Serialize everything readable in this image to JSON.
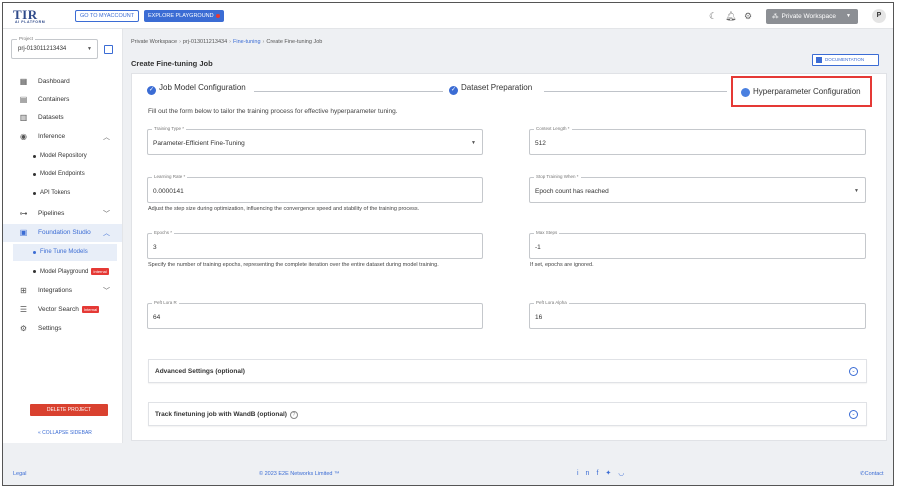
{
  "topbar": {
    "logo_mark": "TIR",
    "logo_sub": "AI PLATFORM",
    "go_myaccount": "GO TO MYACCOUNT",
    "explore_playground": "EXPLORE PLAYGROUND",
    "workspace": "Private Workspace",
    "avatar_initial": "P"
  },
  "sidebar": {
    "project_label": "Project",
    "project_value": "prj-013011213434",
    "items": {
      "dashboard": "Dashboard",
      "containers": "Containers",
      "datasets": "Datasets",
      "inference": "Inference",
      "model_repository": "Model Repository",
      "model_endpoints": "Model Endpoints",
      "api_tokens": "API Tokens",
      "pipelines": "Pipelines",
      "foundation_studio": "Foundation Studio",
      "fine_tune_models": "Fine Tune Models",
      "model_playground": "Model Playground",
      "integrations": "Integrations",
      "vector_search": "Vector Search",
      "settings": "Settings"
    },
    "internal_badge": "Internal",
    "delete_project": "DELETE PROJECT",
    "collapse": "COLLAPSE SIDEBAR"
  },
  "breadcrumb": {
    "workspace": "Private Workspace",
    "project": "prj-013011213434",
    "section": "Fine-tuning",
    "current": "Create Fine-tuning Job"
  },
  "header": {
    "title": "Create Fine-tuning Job",
    "documentation": "DOCUMENTATION"
  },
  "steps": {
    "step1": "Job Model Configuration",
    "step2": "Dataset Preparation",
    "step3": "Hyperparameter Configuration"
  },
  "form": {
    "intro": "Fill out the form below to tailor the training process for effective hyperparameter tuning.",
    "training_type": {
      "label": "Training Type *",
      "value": "Parameter-Efficient Fine-Tuning"
    },
    "context_length": {
      "label": "Context Length *",
      "value": "512"
    },
    "learning_rate": {
      "label": "Learning Rate *",
      "value": "0.0000141",
      "help": "Adjust the step size during optimization, influencing the convergence speed and stability of the training process."
    },
    "stop_training_when": {
      "label": "Stop Training When *",
      "value": "Epoch count has reached"
    },
    "epochs": {
      "label": "Epochs *",
      "value": "3",
      "help": "Specify the number of training epochs, representing the complete iteration over the entire dataset during model training."
    },
    "max_steps": {
      "label": "Max Steps",
      "value": "-1",
      "help": "If set, epochs are ignored."
    },
    "peft_lora_r": {
      "label": "Peft Lora R",
      "value": "64"
    },
    "peft_lora_alpha": {
      "label": "Peft Lora Alpha",
      "value": "16"
    },
    "advanced_settings": "Advanced Settings (optional)",
    "track_wandb": "Track finetuning job with WandB (optional)"
  },
  "footer": {
    "legal": "Legal",
    "copyright": "© 2023 E2E Networks Limited ™",
    "contact": "Contact"
  },
  "colors": {
    "accent": "#3b6cd4",
    "danger": "#d9412f",
    "highlight_box": "#e53935"
  }
}
